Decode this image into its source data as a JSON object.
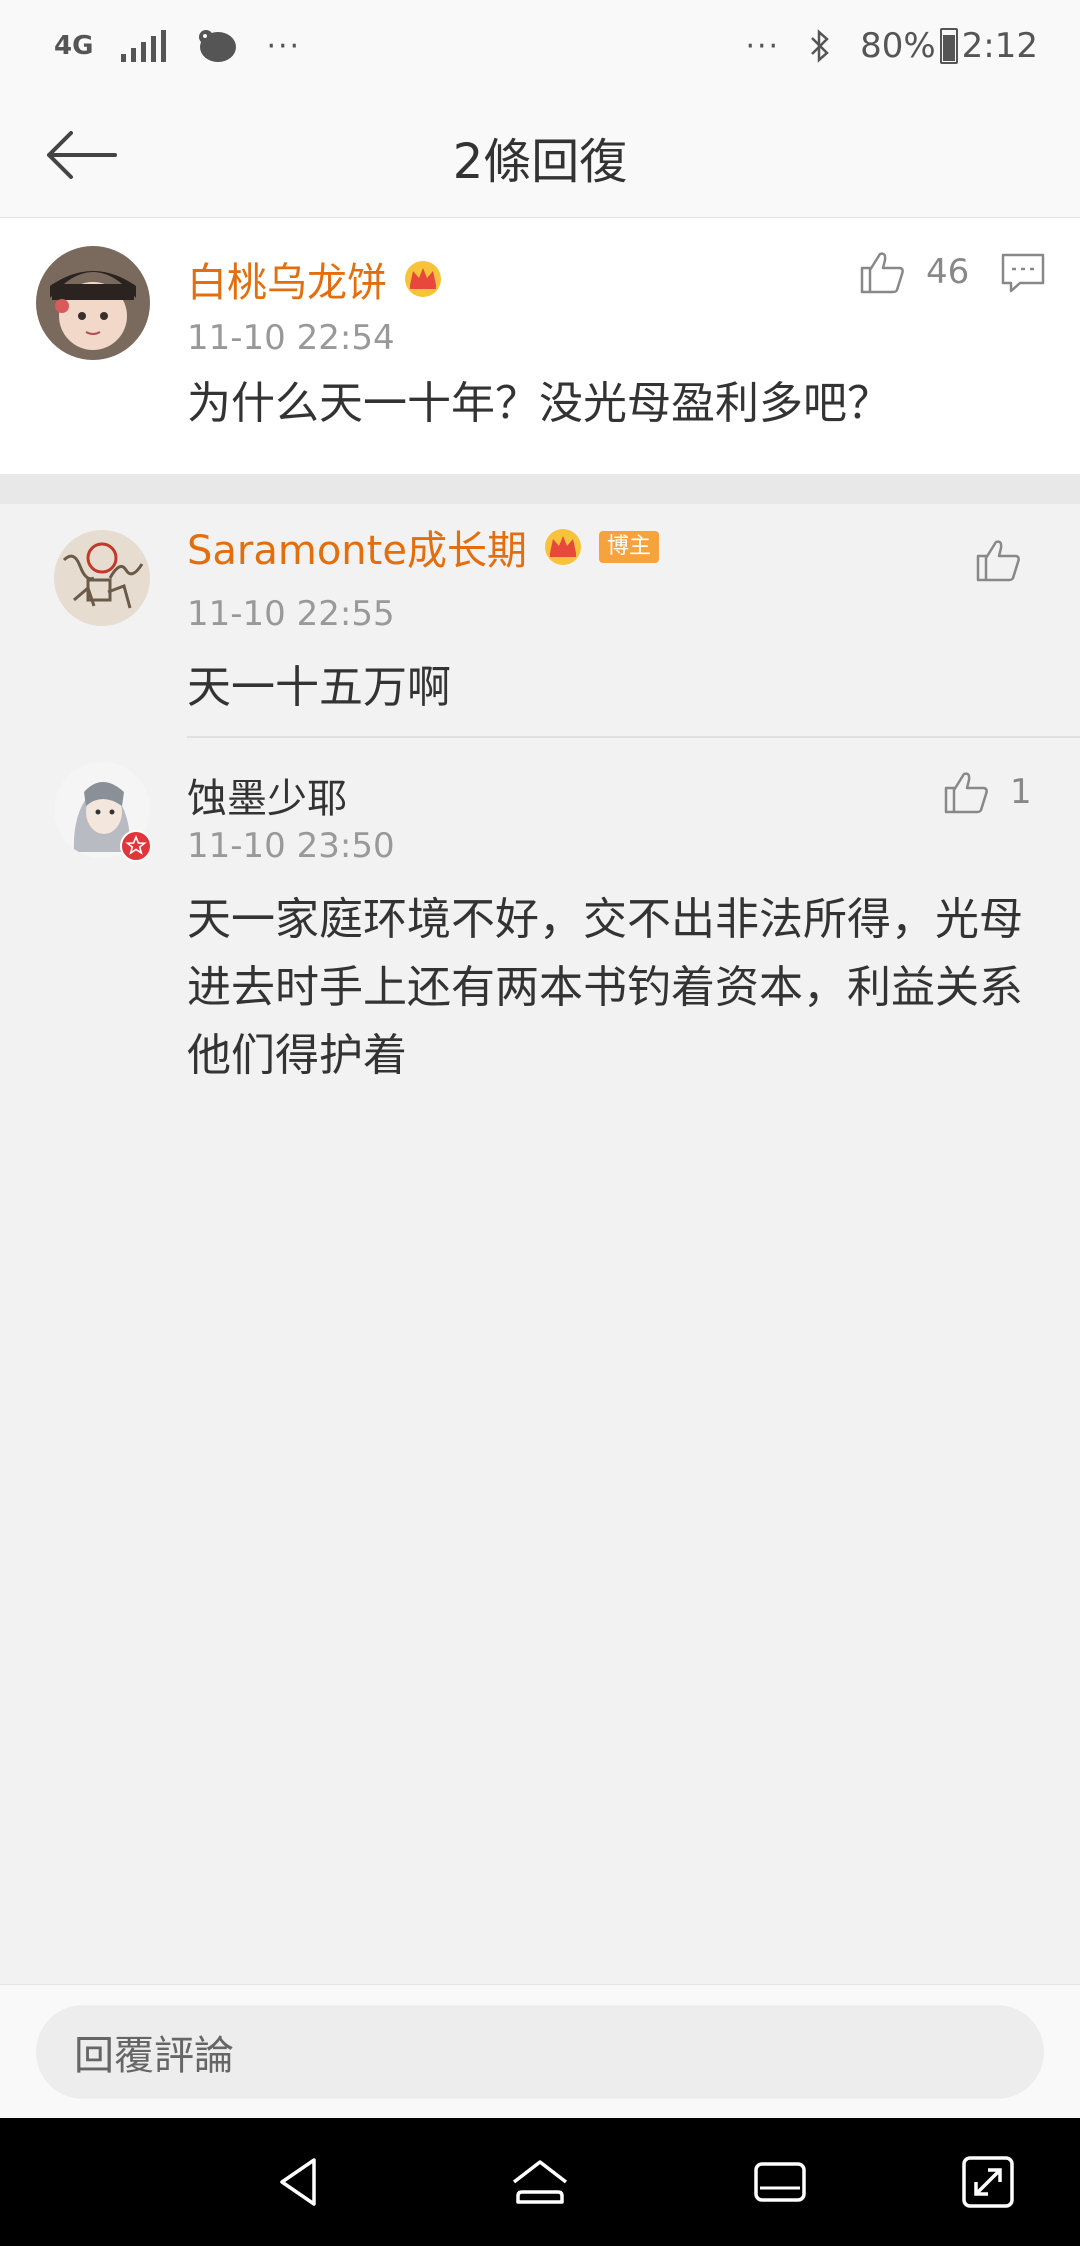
{
  "status_bar": {
    "network": "4G",
    "more_left": "···",
    "more_right": "···",
    "battery_percent": "80%",
    "battery_level": 0.8,
    "time": "2:12"
  },
  "header": {
    "title": "2條回復"
  },
  "root_comment": {
    "username": "白桃乌龙饼",
    "timestamp": "11-10 22:54",
    "text": "为什么天一十年？没光母盈利多吧？",
    "like_count": "46"
  },
  "replies": [
    {
      "username": "Saramonte成长期",
      "badge": "博主",
      "timestamp": "11-10 22:55",
      "text": "天一十五万啊",
      "like_count": ""
    },
    {
      "username": "蚀墨少耶",
      "timestamp": "11-10 23:50",
      "text": "天一家庭环境不好，交不出非法所得，光母进去时手上还有两本书钓着资本，利益关系他们得护着",
      "like_count": "1"
    }
  ],
  "input": {
    "placeholder": "回覆評論"
  },
  "colors": {
    "accent_orange": "#e36e0e",
    "badge_orange": "#f7a33b",
    "background": "#f2f2f2"
  },
  "icons": [
    "back-arrow-icon",
    "like-icon",
    "comment-icon",
    "crown-icon",
    "bluetooth-icon",
    "battery-icon",
    "signal-icon",
    "nav-back-icon",
    "nav-home-icon",
    "nav-recents-icon",
    "nav-expand-icon"
  ]
}
